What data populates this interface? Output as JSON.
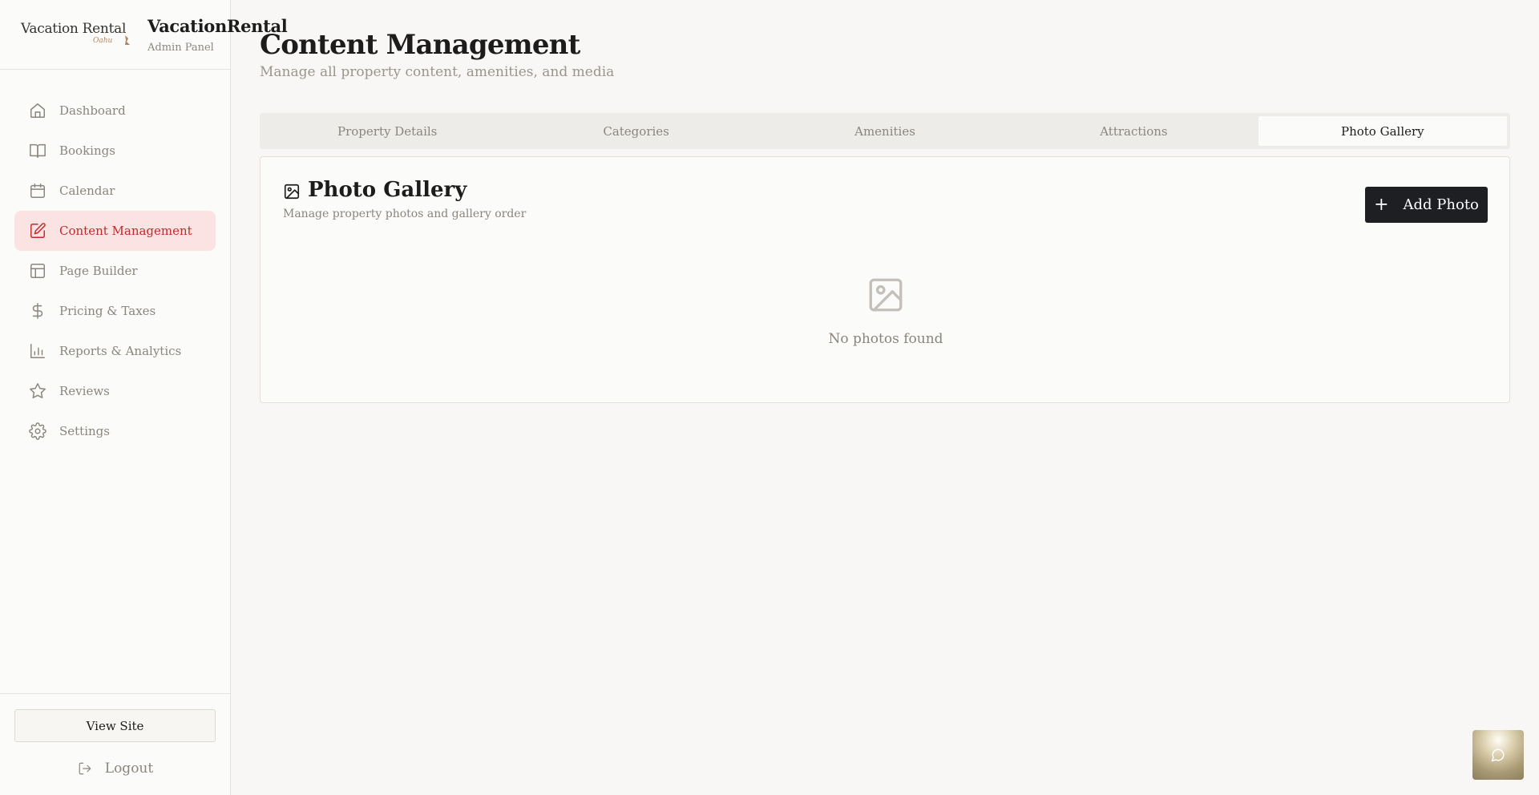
{
  "brand": {
    "logo_text": "Vacation Rental",
    "logo_sub": "Oahu",
    "name": "VacationRental",
    "subtitle": "Admin Panel"
  },
  "nav": [
    {
      "label": "Dashboard",
      "icon": "home-icon",
      "active": false
    },
    {
      "label": "Bookings",
      "icon": "book-icon",
      "active": false
    },
    {
      "label": "Calendar",
      "icon": "calendar-icon",
      "active": false
    },
    {
      "label": "Content Management",
      "icon": "edit-icon",
      "active": true
    },
    {
      "label": "Page Builder",
      "icon": "layout-icon",
      "active": false
    },
    {
      "label": "Pricing & Taxes",
      "icon": "dollar-icon",
      "active": false
    },
    {
      "label": "Reports & Analytics",
      "icon": "bar-chart-icon",
      "active": false
    },
    {
      "label": "Reviews",
      "icon": "star-icon",
      "active": false
    },
    {
      "label": "Settings",
      "icon": "gear-icon",
      "active": false
    }
  ],
  "sidebar_bottom": {
    "view_site": "View Site",
    "logout": "Logout"
  },
  "page": {
    "title": "Content Management",
    "subtitle": "Manage all property content, amenities, and media"
  },
  "tabs": [
    {
      "label": "Property Details",
      "active": false
    },
    {
      "label": "Categories",
      "active": false
    },
    {
      "label": "Amenities",
      "active": false
    },
    {
      "label": "Attractions",
      "active": false
    },
    {
      "label": "Photo Gallery",
      "active": true
    }
  ],
  "gallery": {
    "title": "Photo Gallery",
    "subtitle": "Manage property photos and gallery order",
    "add_button": "Add Photo",
    "empty_text": "No photos found"
  },
  "colors": {
    "accent_active_bg": "#fce3e3",
    "accent_active_text": "#c02a2a",
    "primary_button": "#1d1f23"
  }
}
